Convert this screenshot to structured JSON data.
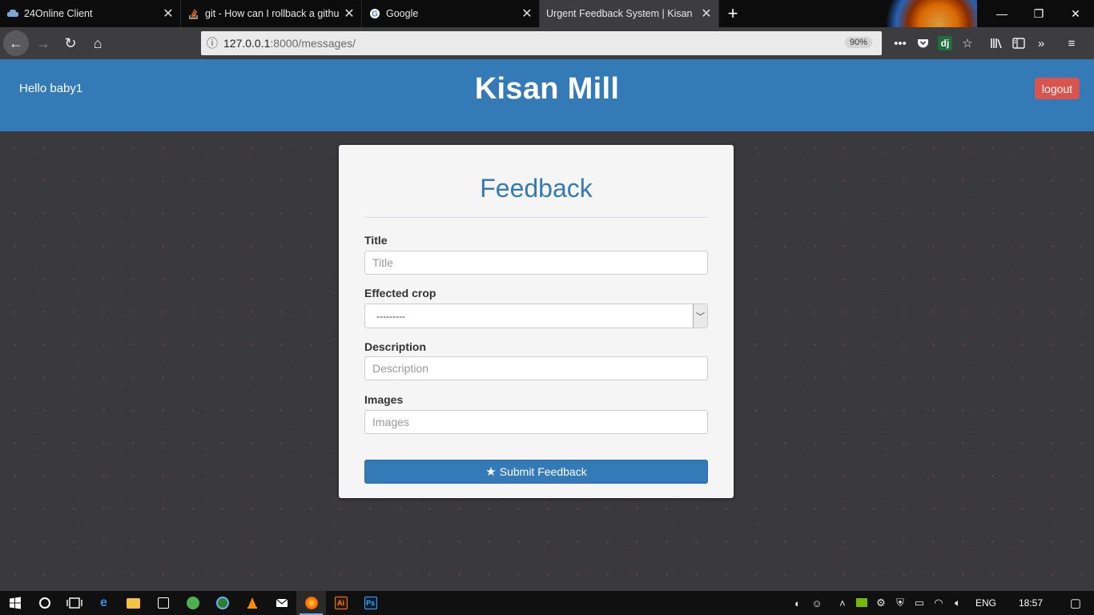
{
  "browser": {
    "tabs": [
      {
        "title": "24Online Client",
        "icon": "cloud-icon",
        "active": false
      },
      {
        "title": "git - How can I rollback a githu",
        "icon": "stackoverflow-icon",
        "active": false
      },
      {
        "title": "Google",
        "icon": "google-icon",
        "active": false
      },
      {
        "title": "Urgent Feedback System | Kisan Mi",
        "icon": "",
        "active": true
      }
    ],
    "url_host": "127.0.0.1",
    "url_path": ":8000/messages/",
    "zoom": "90%"
  },
  "header": {
    "greeting": "Hello baby1",
    "brand": "Kisan Mill",
    "logout_label": "logout"
  },
  "form": {
    "title": "Feedback",
    "fields": {
      "title": {
        "label": "Title",
        "placeholder": "Title"
      },
      "crop": {
        "label": "Effected crop",
        "selected": "---------"
      },
      "description": {
        "label": "Description",
        "placeholder": "Description"
      },
      "images": {
        "label": "Images",
        "placeholder": "Images"
      }
    },
    "submit_label": "Submit Feedback"
  },
  "taskbar": {
    "language": "ENG",
    "clock": "18:57"
  },
  "colors": {
    "primary": "#337ab7",
    "danger": "#d9534f",
    "page_bg": "#3a3a3c"
  }
}
